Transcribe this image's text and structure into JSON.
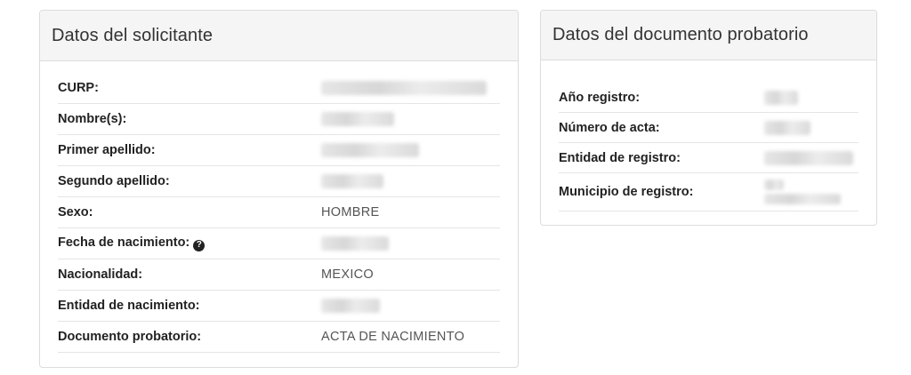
{
  "solicitante": {
    "title": "Datos del solicitante",
    "fields": [
      {
        "label": "CURP:",
        "value": ""
      },
      {
        "label": "Nombre(s):",
        "value": ""
      },
      {
        "label": "Primer apellido:",
        "value": ""
      },
      {
        "label": "Segundo apellido:",
        "value": ""
      },
      {
        "label": "Sexo:",
        "value": "HOMBRE"
      },
      {
        "label": "Fecha de nacimiento:",
        "value": "",
        "icon": "question-circle-icon"
      },
      {
        "label": "Nacionalidad:",
        "value": "MEXICO"
      },
      {
        "label": "Entidad de nacimiento:",
        "value": ""
      },
      {
        "label": "Documento probatorio:",
        "value": "ACTA DE NACIMIENTO"
      }
    ]
  },
  "documento": {
    "title": "Datos del documento probatorio",
    "fields": [
      {
        "label": "Año registro:",
        "value": ""
      },
      {
        "label": "Número de acta:",
        "value": ""
      },
      {
        "label": "Entidad de registro:",
        "value": ""
      },
      {
        "label": "Municipio de registro:",
        "value": ""
      }
    ]
  }
}
